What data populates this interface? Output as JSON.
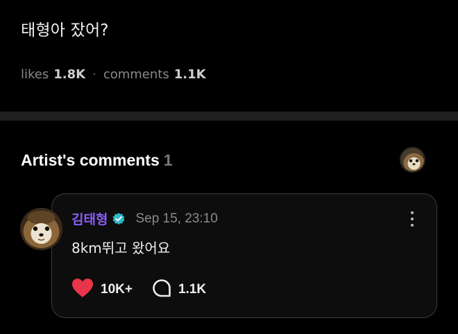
{
  "post": {
    "text": "태형아 잤어?",
    "likes_label": "likes",
    "likes_count": "1.8K",
    "comments_label": "comments",
    "comments_count": "1.1K"
  },
  "artist_comments": {
    "title": "Artist's comments",
    "count": "1",
    "comment": {
      "author": "김태형",
      "verified_icon": "verified-badge-icon",
      "timestamp": "Sep 15, 23:10",
      "body": "8km뛰고 왔어요",
      "like_count": "10K+",
      "reply_count": "1.1K",
      "like_color": "#e8354a",
      "author_color": "#8b5cf6",
      "badge_color": "#2fb8c9"
    }
  }
}
